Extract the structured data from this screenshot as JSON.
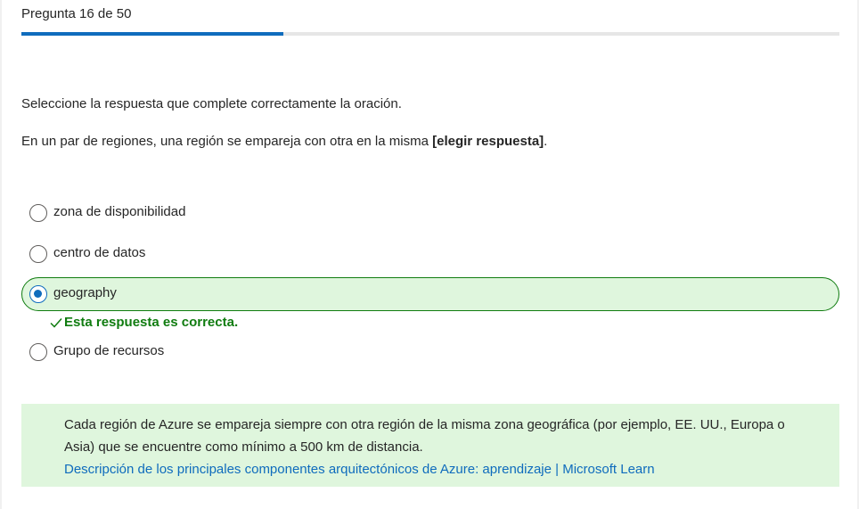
{
  "header": {
    "title": "Pregunta 16 de 50",
    "progress_fraction": 0.32
  },
  "instruction": "Seleccione la respuesta que complete correctamente la oración.",
  "question": {
    "text_before": "En un par de regiones, una región se empareja con otra en la misma ",
    "bold": "[elegir respuesta]",
    "text_after": "."
  },
  "options": [
    {
      "label": "zona de disponibilidad",
      "selected": false
    },
    {
      "label": "centro de datos",
      "selected": false
    },
    {
      "label": "geography",
      "selected": true
    },
    {
      "label": "Grupo de recursos",
      "selected": false
    }
  ],
  "feedback": {
    "text": "Esta respuesta es correcta.",
    "color": "#107c10"
  },
  "explanation": {
    "text": "Cada región de Azure se empareja siempre con otra región de la misma zona geográfica (por ejemplo, EE. UU., Europa o Asia) que se encuentre como mínimo a 500 km de distancia.",
    "link_text": "Descripción de los principales componentes arquitectónicos de Azure: aprendizaje | Microsoft Learn"
  },
  "colors": {
    "accent": "#0f6cbd",
    "success_bg": "#dff6dd",
    "success": "#107c10"
  }
}
